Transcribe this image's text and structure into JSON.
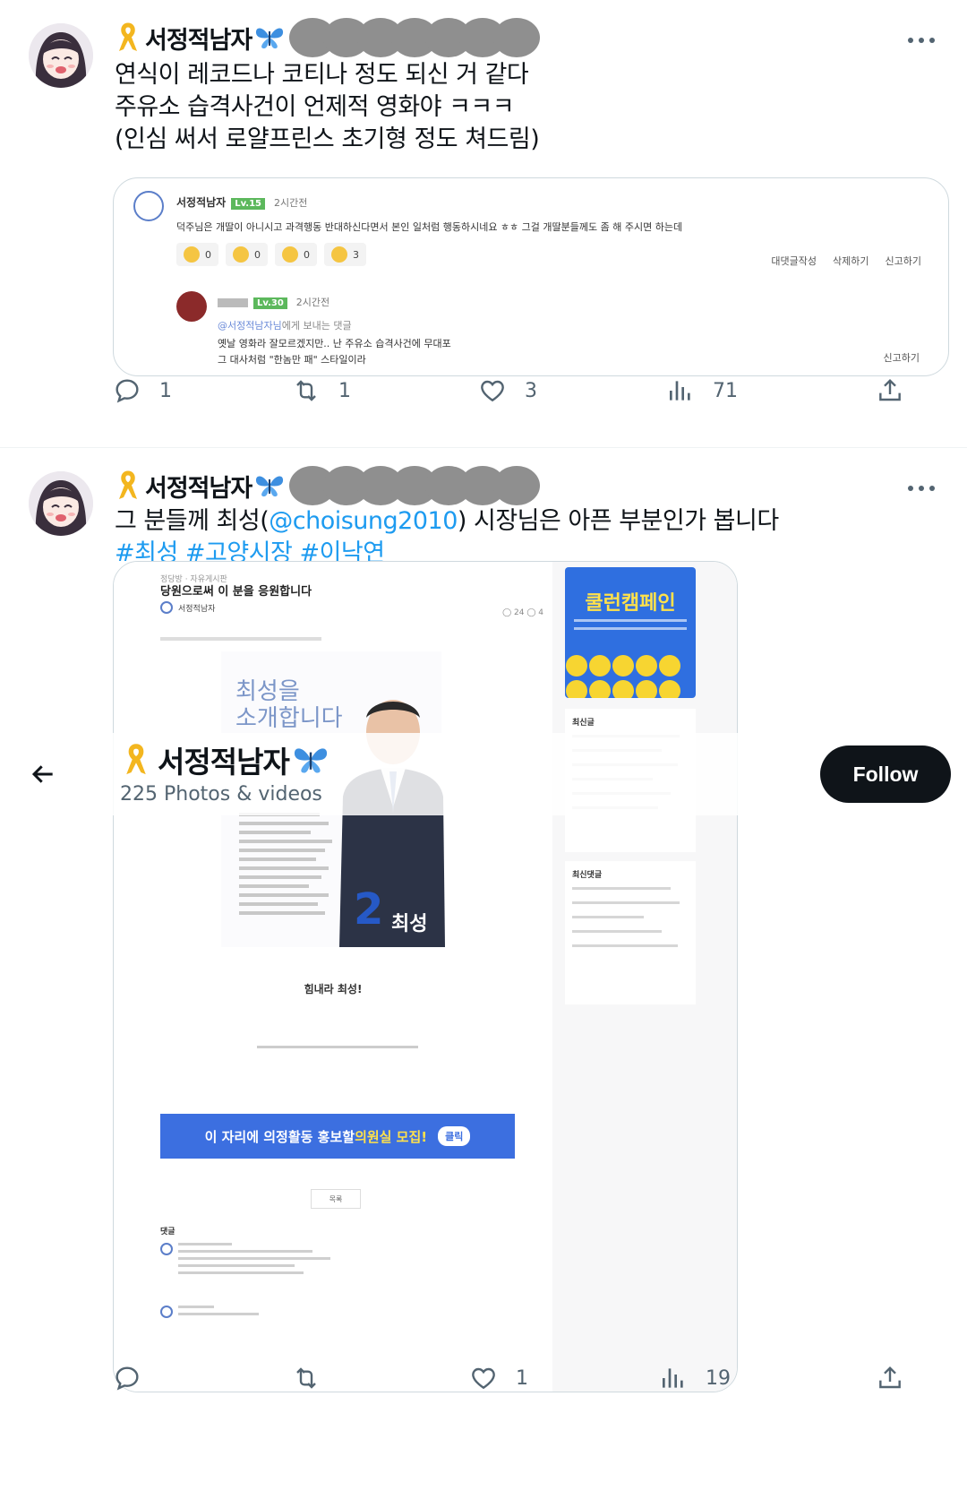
{
  "tweets": [
    {
      "author": {
        "display_name": "서정적남자"
      },
      "text_lines": [
        "연식이 레코드나 코티나 정도 되신 거 같다",
        "주유소 습격사건이 언제적 영화야 ㅋㅋㅋ",
        "(인심 써서 로얄프린스 초기형 정도 쳐드림)"
      ],
      "embedded_comment": {
        "author": "서정적남자",
        "level": "Lv.15",
        "time": "2시간전",
        "text": "덕주님은 개딸이 아니시고 과격행동 반대하신다면서 본인 일처럼 행동하시네요 ㅎㅎ 그걸 개딸분들께도 좀 해 주시면 하는데",
        "reactions": [
          "0",
          "0",
          "0",
          "3"
        ],
        "actions": [
          "대댓글작성",
          "삭제하기",
          "신고하기"
        ],
        "reply": {
          "level": "Lv.30",
          "time": "2시간전",
          "reply_to": "@서정적남자님",
          "reply_to_suffix": "에게 보내는 댓글",
          "line1": "옛날 영화라 잘모르겠지만.. 난 주유소 습격사건에 무대포",
          "line2": "그 대사처럼 \"한놈만 패\" 스타일이라",
          "report": "신고하기"
        }
      },
      "stats": {
        "replies": "1",
        "retweets": "1",
        "likes": "3",
        "views": "71"
      }
    },
    {
      "author": {
        "display_name": "서정적남자"
      },
      "text_before": "그 분들께 최성(",
      "mention": "@choisung2010",
      "text_after": ") 시장님은 아픈 부분인가 봅니다",
      "hashtags": "#최성 #고양시장 #이낙연",
      "embedded_post": {
        "breadcrumb": "정당방 · 자유게시판",
        "title": "당원으로써 이 분을 응원합니다",
        "author": "서정적남자",
        "meta": "◯ 24  ◯ 4",
        "poster_headline_1": "최성을",
        "poster_headline_2": "소개합니다",
        "poster_number": "2",
        "poster_name": "최성",
        "cheer": "힘내라 최성!",
        "banner_text_1": "이 자리에 의정활동 홍보할 ",
        "banner_text_highlight": "의원실 모집!",
        "banner_button": "클릭",
        "list_button": "목록",
        "comments_header": "댓글",
        "side_campaign": "쿨런캠페인",
        "side_recent": "최신글",
        "side_recent_comments": "최신댓글"
      },
      "stats": {
        "replies": "",
        "retweets": "",
        "likes": "1",
        "views": "19"
      }
    }
  ],
  "media_header": {
    "display_name": "서정적남자",
    "count_text": "225 Photos & videos",
    "follow_label": "Follow"
  },
  "colors": {
    "accent": "#1d9bf0",
    "text": "#0f1419",
    "muted": "#536471",
    "ribbon": "#f3b61f",
    "butterfly": "#3d8fe0"
  },
  "icons": [
    "reply-icon",
    "retweet-icon",
    "like-icon",
    "views-icon",
    "share-icon",
    "more-icon",
    "yellow-ribbon-icon",
    "butterfly-icon",
    "back-arrow-icon"
  ]
}
